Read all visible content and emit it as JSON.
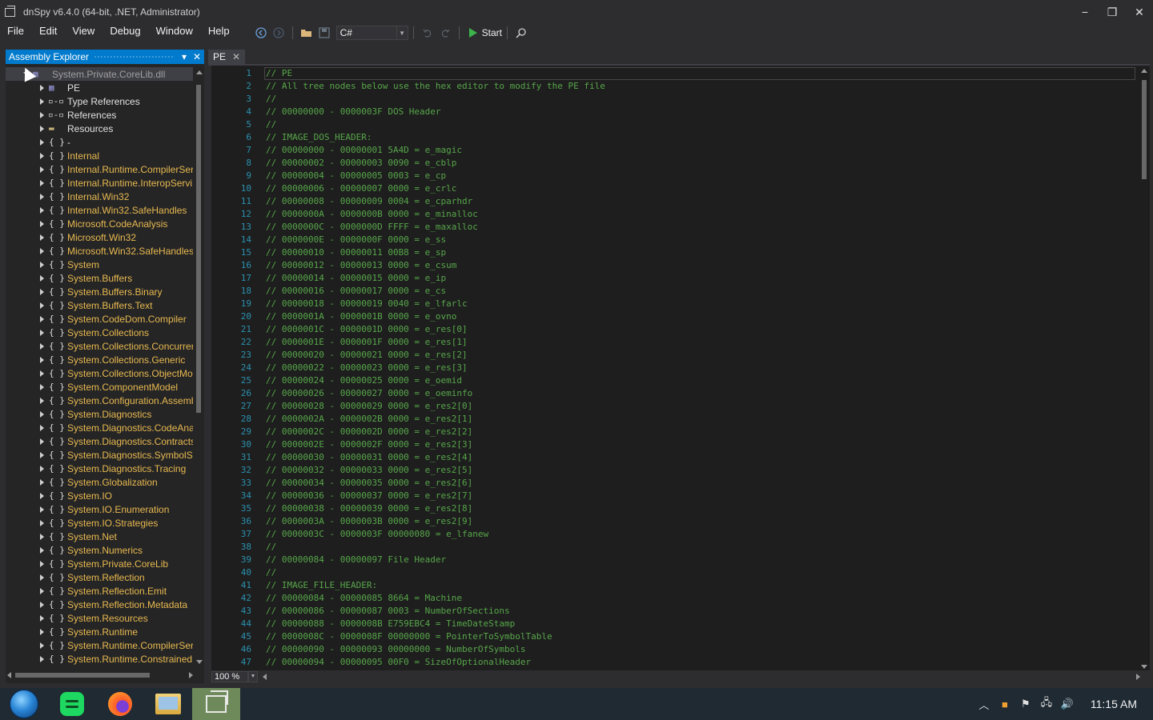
{
  "window": {
    "title": "dnSpy v6.4.0 (64-bit, .NET, Administrator)",
    "controls": {
      "minimize": "−",
      "restore": "❐",
      "close": "✕"
    }
  },
  "menu": [
    "File",
    "Edit",
    "View",
    "Debug",
    "Window",
    "Help"
  ],
  "toolbar": {
    "language": "C#",
    "start_label": "Start",
    "icons": [
      "back-icon",
      "forward-icon",
      "open-icon",
      "save-icon",
      "undo-icon",
      "redo-icon",
      "search-icon"
    ]
  },
  "explorer": {
    "title": "Assembly Explorer",
    "root": "System.Private.CoreLib.dll",
    "pe": "PE",
    "children": [
      "Type References",
      "References",
      "Resources"
    ],
    "namespaces": [
      "-",
      "Internal",
      "Internal.Runtime.CompilerSer",
      "Internal.Runtime.InteropServi",
      "Internal.Win32",
      "Internal.Win32.SafeHandles",
      "Microsoft.CodeAnalysis",
      "Microsoft.Win32",
      "Microsoft.Win32.SafeHandles",
      "System",
      "System.Buffers",
      "System.Buffers.Binary",
      "System.Buffers.Text",
      "System.CodeDom.Compiler",
      "System.Collections",
      "System.Collections.Concurrer",
      "System.Collections.Generic",
      "System.Collections.ObjectMo",
      "System.ComponentModel",
      "System.Configuration.Assemb",
      "System.Diagnostics",
      "System.Diagnostics.CodeAnal",
      "System.Diagnostics.Contracts",
      "System.Diagnostics.SymbolSt",
      "System.Diagnostics.Tracing",
      "System.Globalization",
      "System.IO",
      "System.IO.Enumeration",
      "System.IO.Strategies",
      "System.Net",
      "System.Numerics",
      "System.Private.CoreLib",
      "System.Reflection",
      "System.Reflection.Emit",
      "System.Reflection.Metadata",
      "System.Resources",
      "System.Runtime",
      "System.Runtime.CompilerSer",
      "System.Runtime.ConstrainedE"
    ]
  },
  "document": {
    "tab_label": "PE",
    "zoom": "100 %",
    "lines": [
      "// PE",
      "// All tree nodes below use the hex editor to modify the PE file",
      "//",
      "// 00000000 - 0000003F DOS Header",
      "//",
      "// IMAGE_DOS_HEADER:",
      "// 00000000 - 00000001 5A4D = e_magic",
      "// 00000002 - 00000003 0090 = e_cblp",
      "// 00000004 - 00000005 0003 = e_cp",
      "// 00000006 - 00000007 0000 = e_crlc",
      "// 00000008 - 00000009 0004 = e_cparhdr",
      "// 0000000A - 0000000B 0000 = e_minalloc",
      "// 0000000C - 0000000D FFFF = e_maxalloc",
      "// 0000000E - 0000000F 0000 = e_ss",
      "// 00000010 - 00000011 00B8 = e_sp",
      "// 00000012 - 00000013 0000 = e_csum",
      "// 00000014 - 00000015 0000 = e_ip",
      "// 00000016 - 00000017 0000 = e_cs",
      "// 00000018 - 00000019 0040 = e_lfarlc",
      "// 0000001A - 0000001B 0000 = e_ovno",
      "// 0000001C - 0000001D 0000 = e_res[0]",
      "// 0000001E - 0000001F 0000 = e_res[1]",
      "// 00000020 - 00000021 0000 = e_res[2]",
      "// 00000022 - 00000023 0000 = e_res[3]",
      "// 00000024 - 00000025 0000 = e_oemid",
      "// 00000026 - 00000027 0000 = e_oeminfo",
      "// 00000028 - 00000029 0000 = e_res2[0]",
      "// 0000002A - 0000002B 0000 = e_res2[1]",
      "// 0000002C - 0000002D 0000 = e_res2[2]",
      "// 0000002E - 0000002F 0000 = e_res2[3]",
      "// 00000030 - 00000031 0000 = e_res2[4]",
      "// 00000032 - 00000033 0000 = e_res2[5]",
      "// 00000034 - 00000035 0000 = e_res2[6]",
      "// 00000036 - 00000037 0000 = e_res2[7]",
      "// 00000038 - 00000039 0000 = e_res2[8]",
      "// 0000003A - 0000003B 0000 = e_res2[9]",
      "// 0000003C - 0000003F 00000080 = e_lfanew",
      "//",
      "// 00000084 - 00000097 File Header",
      "//",
      "// IMAGE_FILE_HEADER:",
      "// 00000084 - 00000085 8664 = Machine",
      "// 00000086 - 00000087 0003 = NumberOfSections",
      "// 00000088 - 0000008B E759EBC4 = TimeDateStamp",
      "// 0000008C - 0000008F 00000000 = PointerToSymbolTable",
      "// 00000090 - 00000093 00000000 = NumberOfSymbols",
      "// 00000094 - 00000095 00F0 = SizeOfOptionalHeader",
      "// 00000096 - 00000097 2022 = Characteristics"
    ]
  },
  "taskbar": {
    "apps": [
      "start-orb",
      "spotify-icon",
      "firefox-icon",
      "file-explorer-icon",
      "dnspy-icon"
    ],
    "clock": "11:15 AM"
  },
  "colors": {
    "accent": "#007acc",
    "comment": "#57a64a",
    "line_number": "#2b91af",
    "namespace": "#e8b94f"
  }
}
